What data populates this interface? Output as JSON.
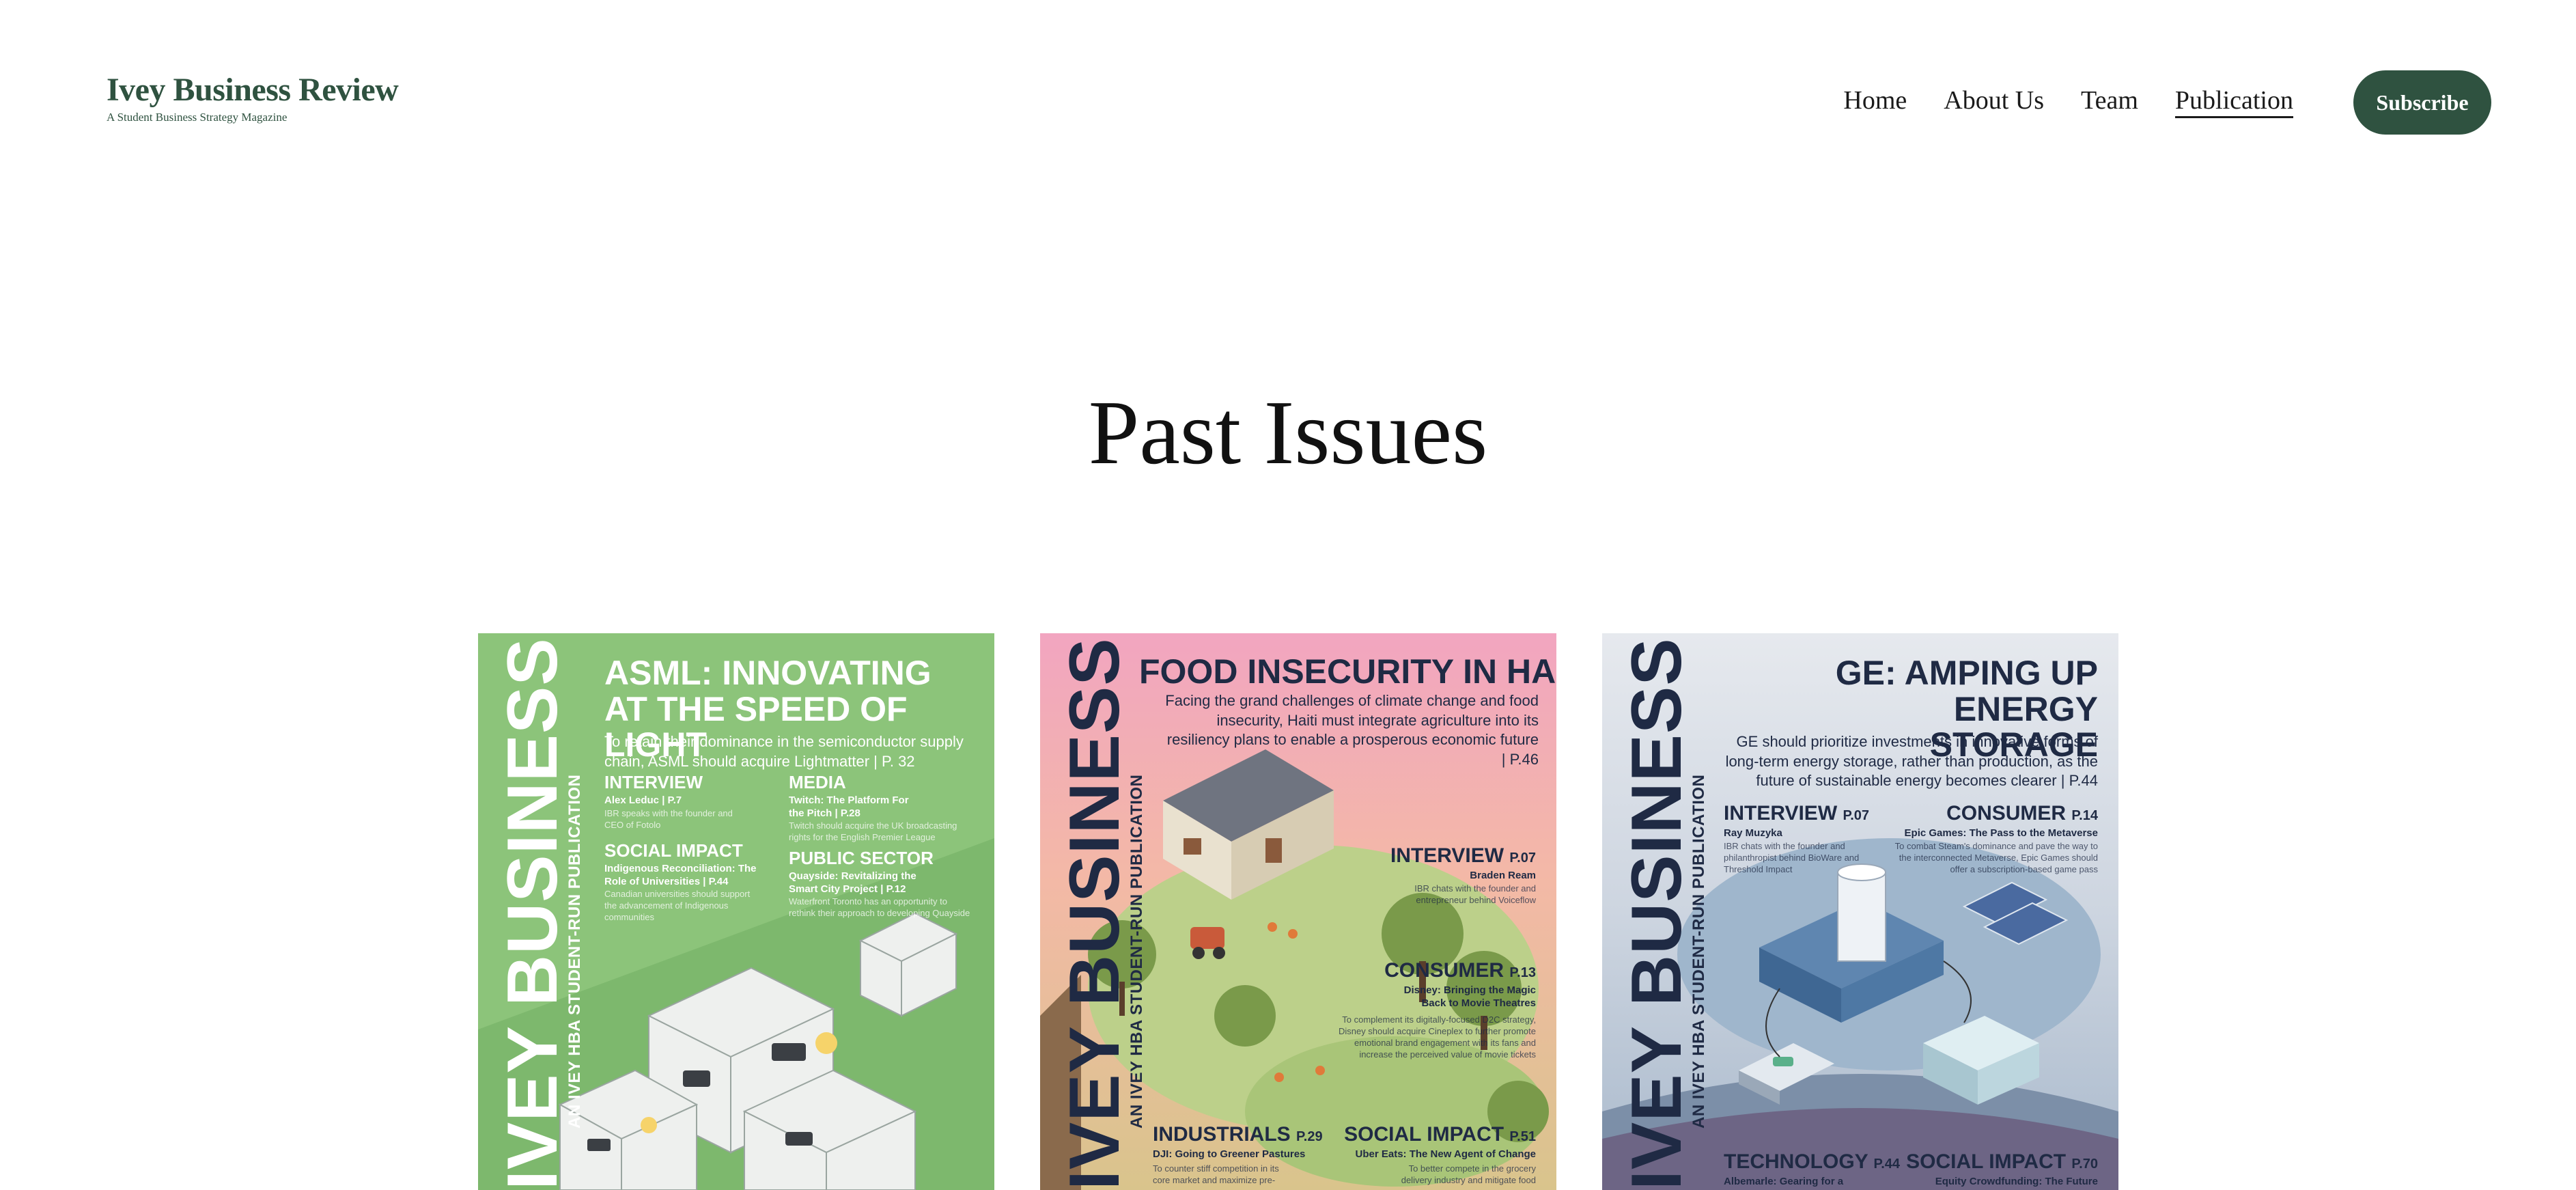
{
  "brand": {
    "title": "Ivey Business Review",
    "tagline": "A Student Business Strategy Magazine",
    "color": "#2f5240"
  },
  "nav": {
    "items": [
      "Home",
      "About Us",
      "Team",
      "Publication"
    ],
    "active": "Publication",
    "subscribe_label": "Subscribe"
  },
  "main": {
    "title": "Past Issues"
  },
  "issues": [
    {
      "spine": "IVEY BUSINESS REVIEW",
      "spine_sub": "AN IVEY HBA STUDENT-RUN PUBLICATION",
      "headline": "ASML: INNOVATING AT THE SPEED OF LIGHT",
      "lead": "To retain their dominance in the semiconductor supply chain, ASML should acquire Lightmatter | P. 32",
      "sections": [
        {
          "label": "INTERVIEW",
          "sub": "Alex Leduc | P.7",
          "body": "IBR speaks with the founder and CEO of Fotolo"
        },
        {
          "label": "MEDIA",
          "sub": "Twitch: The Platform For the Pitch | P.28",
          "body": "Twitch should acquire the UK broadcasting rights for the English Premier League"
        },
        {
          "label": "SOCIAL IMPACT",
          "sub": "Indigenous Reconciliation: The Role of Universities | P.44",
          "body": "Canadian universities should support the advancement of Indigenous communities"
        },
        {
          "label": "PUBLIC SECTOR",
          "sub": "Quayside: Revitalizing the Smart City Project | P.12",
          "body": "Waterfront Toronto has an opportunity to rethink their approach to developing Quayside"
        }
      ],
      "accent": "#ffffff"
    },
    {
      "spine": "IVEY BUSINESS REVIEW",
      "spine_sub": "AN IVEY HBA STUDENT-RUN PUBLICATION",
      "headline": "FOOD INSECURITY IN HAITI",
      "lead": "Facing the grand challenges of climate change and food insecurity, Haiti must integrate agriculture into its resiliency plans to enable a prosperous economic future | P.46",
      "sections": [
        {
          "label": "INTERVIEW",
          "page": "P.07",
          "sub": "Braden Ream",
          "body": "IBR chats with the founder and entrepreneur behind Voiceflow"
        },
        {
          "label": "CONSUMER",
          "page": "P.13",
          "sub": "Disney: Bringing the Magic Back to Movie Theatres",
          "body": "To complement its digitally-focused D2C strategy, Disney should acquire Cineplex to further promote emotional brand engagement with its fans and increase the perceived value of movie tickets"
        },
        {
          "label": "INDUSTRIALS",
          "page": "P.29",
          "sub": "DJI: Going to Greener Pastures",
          "body": "To counter stiff competition in its core market and maximize pre-"
        },
        {
          "label": "SOCIAL IMPACT",
          "page": "P.51",
          "sub": "Uber Eats: The New Agent of Change",
          "body": "To better compete in the grocery delivery industry and mitigate food"
        }
      ],
      "accent": "#1f2a44"
    },
    {
      "spine": "IVEY BUSINESS REVIEW",
      "spine_sub": "AN IVEY HBA STUDENT-RUN PUBLICATION",
      "headline": "GE: AMPING UP ENERGY STORAGE",
      "lead": "GE should prioritize investments in innovative forms of long-term energy storage, rather than production, as the future of sustainable energy becomes clearer | P.44",
      "sections": [
        {
          "label": "INTERVIEW",
          "page": "P.07",
          "sub": "Ray Muzyka",
          "body": "IBR chats with the founder and philanthropist behind BioWare and Threshold Impact"
        },
        {
          "label": "CONSUMER",
          "page": "P.14",
          "sub": "Epic Games: The Pass to the Metaverse",
          "body": "To combat Steam's dominance and pave the way to the interconnected Metaverse, Epic Games should offer a subscription-based game pass"
        },
        {
          "label": "TECHNOLOGY",
          "page": "P.44",
          "sub": "Albemarle: Gearing for a",
          "body": ""
        },
        {
          "label": "SOCIAL IMPACT",
          "page": "P.70",
          "sub": "Equity Crowdfunding: The Future",
          "body": ""
        }
      ],
      "accent": "#1f2a44"
    }
  ]
}
